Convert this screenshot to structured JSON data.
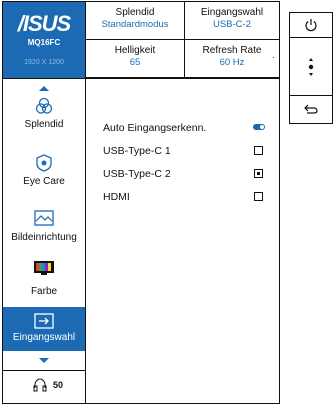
{
  "brand": {
    "logo": "/ISUS",
    "model": "MQ16FC",
    "resolution": "1920 X 1200"
  },
  "info": {
    "splendid": {
      "label": "Splendid",
      "value": "Standardmodus"
    },
    "input": {
      "label": "Eingangswahl",
      "value": "USB-C-2"
    },
    "brightness": {
      "label": "Helligkeit",
      "value": "65"
    },
    "refresh": {
      "label": "Refresh Rate",
      "value": "60 Hz"
    }
  },
  "sidebar": {
    "items": [
      {
        "label": "Splendid",
        "icon": "splendid-icon"
      },
      {
        "label": "Eye Care",
        "icon": "eye-care-icon"
      },
      {
        "label": "Bildeinrichtung",
        "icon": "image-setup-icon"
      },
      {
        "label": "Farbe",
        "icon": "color-icon"
      },
      {
        "label": "Eingangswahl",
        "icon": "input-select-icon",
        "active": true
      }
    ]
  },
  "volume": {
    "value": "50",
    "icon": "headphone-icon"
  },
  "options": [
    {
      "label": "Auto Eingangserkenn.",
      "control": "toggle",
      "state": "on"
    },
    {
      "label": "USB-Type-C 1",
      "control": "checkbox",
      "checked": false
    },
    {
      "label": "USB-Type-C 2",
      "control": "checkbox",
      "checked": true
    },
    {
      "label": "HDMI",
      "control": "checkbox",
      "checked": false
    }
  ],
  "controls": {
    "power_icon": "power-icon",
    "nav_icon": "nav-dots-icon",
    "back_icon": "back-arrow-icon"
  },
  "colors": {
    "accent": "#1b6ab3"
  }
}
